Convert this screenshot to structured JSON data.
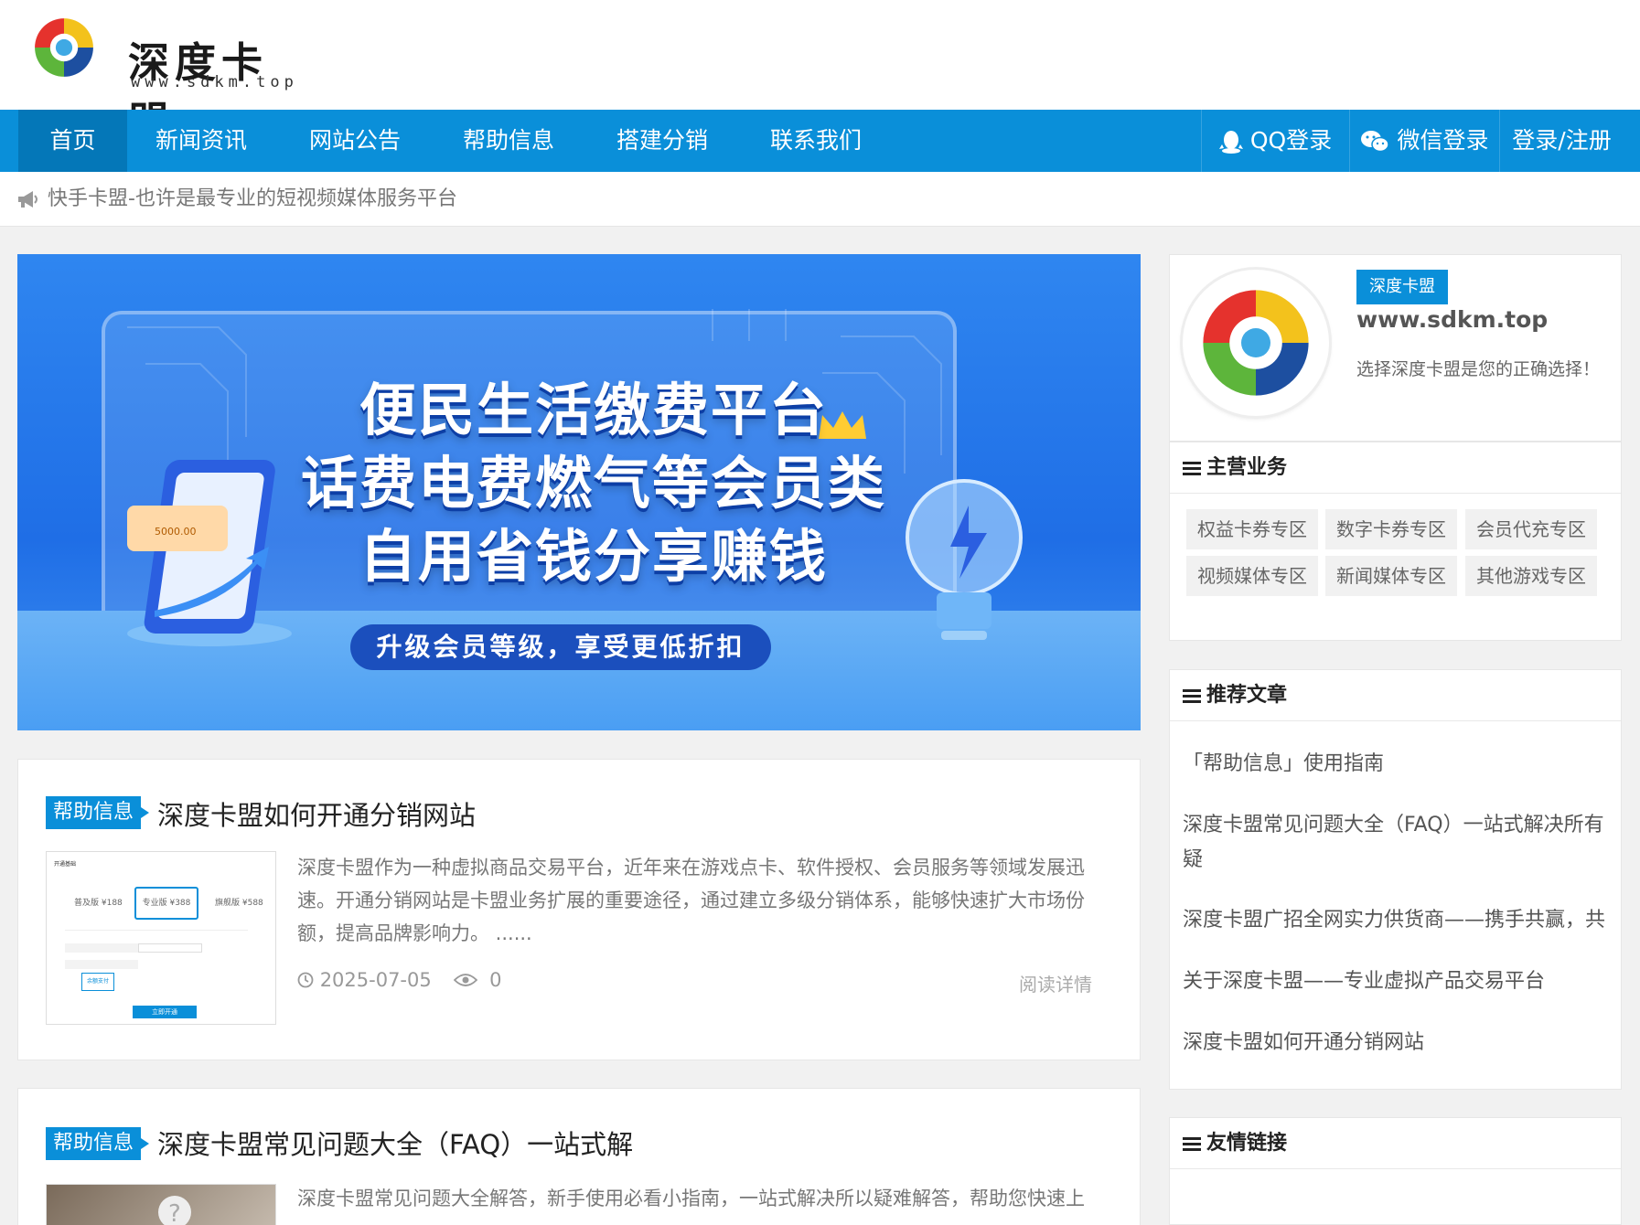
{
  "header": {
    "logo_text": "深度卡盟",
    "logo_sub": "www.sdkm.top"
  },
  "nav": {
    "items": [
      "首页",
      "新闻资讯",
      "网站公告",
      "帮助信息",
      "搭建分销",
      "联系我们"
    ],
    "active_index": 0,
    "qq_login": "QQ登录",
    "wechat_login": "微信登录",
    "login_register": "登录/注册"
  },
  "notice": {
    "text": "快手卡盟-也许是最专业的短视频媒体服务平台"
  },
  "banner": {
    "line1": "便民生活缴费平台",
    "line2": "话费电费燃气等会员类",
    "line3": "自用省钱分享赚钱",
    "pill": "升级会员等级，享受更低折扣",
    "card_amount": "5000.00"
  },
  "articles": [
    {
      "tag": "帮助信息",
      "title": "深度卡盟如何开通分销网站",
      "excerpt": "深度卡盟作为一种虚拟商品交易平台，近年来在游戏点卡、软件授权、会员服务等领域发展迅速。开通分销网站是卡盟业务扩展的重要途径，通过建立多级分销体系，能够快速扩大市场份额，提高品牌影响力。 ......",
      "date": "2025-07-05",
      "views": "0",
      "read_more": "阅读详情",
      "thumb": {
        "title": "开通基础",
        "plan1": "普及版 ¥188",
        "plan2": "专业版 ¥388",
        "plan3": "旗舰版 ¥588",
        "btn": "立即开通",
        "pay": "余额支付"
      }
    },
    {
      "tag": "帮助信息",
      "title": "深度卡盟常见问题大全（FAQ）一站式解",
      "excerpt": "深度卡盟常见问题大全解答，新手使用必看小指南，一站式解决所以疑难解答，帮助您快速上"
    }
  ],
  "sidebar": {
    "profile": {
      "badge": "深度卡盟",
      "url": "www.sdkm.top",
      "slogan": "选择深度卡盟是您的正确选择！"
    },
    "business": {
      "title": "主营业务",
      "chips": [
        "权益卡券专区",
        "数字卡券专区",
        "会员代充专区",
        "视频媒体专区",
        "新闻媒体专区",
        "其他游戏专区"
      ]
    },
    "recommend": {
      "title": "推荐文章",
      "items": [
        "「帮助信息」使用指南",
        "深度卡盟常见问题大全（FAQ）一站式解决所有疑",
        "深度卡盟广招全网实力供货商——携手共赢，共",
        "关于深度卡盟——专业虚拟产品交易平台",
        "深度卡盟如何开通分销网站"
      ]
    },
    "links": {
      "title": "友情链接"
    }
  },
  "colors": {
    "primary": "#0a8fd9",
    "primary_dark": "#0477b8",
    "background": "#f1f1f1"
  }
}
